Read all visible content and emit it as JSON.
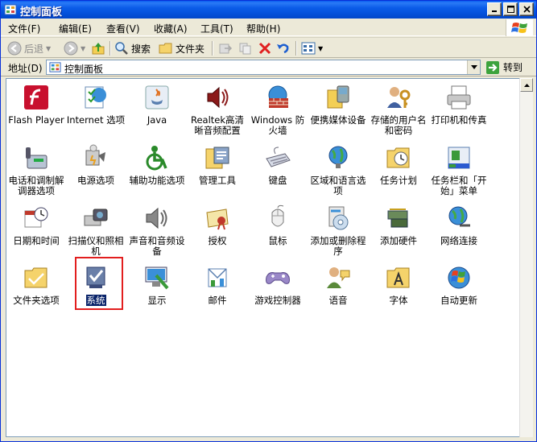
{
  "window": {
    "title": "控制面板"
  },
  "menu": [
    "文件(F)",
    "编辑(E)",
    "查看(V)",
    "收藏(A)",
    "工具(T)",
    "帮助(H)"
  ],
  "toolbar": {
    "back": "后退",
    "search": "搜索",
    "folders": "文件夹"
  },
  "address": {
    "label": "地址(D)",
    "value": "控制面板",
    "go": "转到"
  },
  "items": [
    {
      "label": "Flash Player",
      "icon": "flash-icon"
    },
    {
      "label": "Internet 选项",
      "icon": "internet-options-icon"
    },
    {
      "label": "Java",
      "icon": "java-icon"
    },
    {
      "label": "Realtek高清晰音频配置",
      "icon": "realtek-audio-icon"
    },
    {
      "label": "Windows 防火墙",
      "icon": "firewall-icon"
    },
    {
      "label": "便携媒体设备",
      "icon": "portable-media-icon"
    },
    {
      "label": "存储的用户名和密码",
      "icon": "stored-credentials-icon"
    },
    {
      "label": "打印机和传真",
      "icon": "printer-icon"
    },
    {
      "label": "电话和调制解调器选项",
      "icon": "phone-modem-icon"
    },
    {
      "label": "电源选项",
      "icon": "power-options-icon"
    },
    {
      "label": "辅助功能选项",
      "icon": "accessibility-icon"
    },
    {
      "label": "管理工具",
      "icon": "admin-tools-icon"
    },
    {
      "label": "键盘",
      "icon": "keyboard-icon"
    },
    {
      "label": "区域和语言选项",
      "icon": "region-language-icon"
    },
    {
      "label": "任务计划",
      "icon": "scheduled-tasks-icon"
    },
    {
      "label": "任务栏和「开始」菜单",
      "icon": "taskbar-icon"
    },
    {
      "label": "日期和时间",
      "icon": "date-time-icon"
    },
    {
      "label": "扫描仪和照相机",
      "icon": "scanner-camera-icon"
    },
    {
      "label": "声音和音频设备",
      "icon": "sound-icon"
    },
    {
      "label": "授权",
      "icon": "license-icon"
    },
    {
      "label": "鼠标",
      "icon": "mouse-icon"
    },
    {
      "label": "添加或删除程序",
      "icon": "add-remove-programs-icon"
    },
    {
      "label": "添加硬件",
      "icon": "add-hardware-icon"
    },
    {
      "label": "网络连接",
      "icon": "network-icon"
    },
    {
      "label": "文件夹选项",
      "icon": "folder-options-icon"
    },
    {
      "label": "系统",
      "icon": "system-icon",
      "selected": true
    },
    {
      "label": "显示",
      "icon": "display-icon"
    },
    {
      "label": "邮件",
      "icon": "mail-icon"
    },
    {
      "label": "游戏控制器",
      "icon": "game-controller-icon"
    },
    {
      "label": "语音",
      "icon": "speech-icon"
    },
    {
      "label": "字体",
      "icon": "fonts-icon"
    },
    {
      "label": "自动更新",
      "icon": "auto-update-icon"
    }
  ],
  "colors": {
    "titlebar": "#0350d9",
    "selection": "#0a246a",
    "highlight_box": "#e21e1e"
  }
}
